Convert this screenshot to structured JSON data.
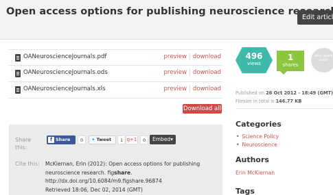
{
  "header": {
    "title": "Open access options for publishing neuroscience research",
    "edit_label": "Edit article"
  },
  "files": [
    {
      "name": "OANeuroscienceJournals.pdf",
      "preview": "preview",
      "download": "download"
    },
    {
      "name": "OANeuroscienceJournals.ods",
      "preview": "preview",
      "download": "download"
    },
    {
      "name": "OANeuroscienceJournals.xls",
      "preview": "preview",
      "download": "download"
    }
  ],
  "download_all_label": "Download all",
  "share": {
    "label": "Share this:",
    "facebook_label": "Share",
    "facebook_count": "0",
    "tweet_label": "Tweet",
    "tweet_count": "1",
    "gplus_label": "g+1",
    "gplus_count": "0",
    "embed_label": "Embed"
  },
  "cite": {
    "label": "Cite this:",
    "line1": "McKiernan, Erin (2012): Open access options for publishing",
    "line2_prefix": "neuroscience research. fig",
    "line2_bold": "share",
    "line2_suffix": ".",
    "line3": "http://dx.doi.org/10.6084/m9.figshare.96874",
    "line4": "Retrieved 18:06, Dec 02, 2014 (GMT)"
  },
  "stats": {
    "views_count": "496",
    "views_label": "views",
    "shares_count": "1",
    "shares_label": "shares",
    "altmetric_text": "altm score soon"
  },
  "published": {
    "prefix": "Published on ",
    "date": "26 Oct 2012 - 18:49 (GMT)",
    "filesize_prefix": "Filesize in total is ",
    "filesize": "146.77 KB"
  },
  "categories": {
    "title": "Categories",
    "items": [
      "Science Policy",
      "Neuroscience"
    ]
  },
  "authors": {
    "title": "Authors",
    "items": [
      "Erin McKiernan"
    ]
  },
  "tags": {
    "title": "Tags"
  },
  "colors": {
    "accent_red": "#d05050",
    "views_teal": "#3fb9aa",
    "shares_green": "#8cc63f",
    "facebook_blue": "#3b5998",
    "dark_button": "#444444"
  }
}
